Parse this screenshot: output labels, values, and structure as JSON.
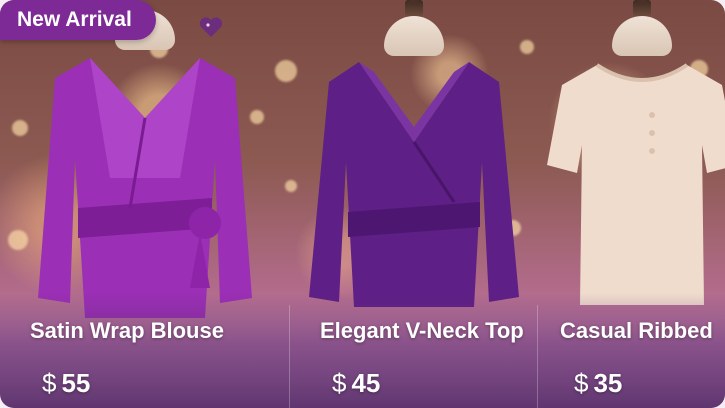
{
  "badge": {
    "label": "New Arrival"
  },
  "colors": {
    "badge_bg": "#7d2a97",
    "accent": "#6d2d7d"
  },
  "products": [
    {
      "name": "Satin Wrap Blouse",
      "currency": "$",
      "price": "55",
      "garment_color": "#9b2fb5"
    },
    {
      "name": "Elegant V-Neck Top",
      "currency": "$",
      "price": "45",
      "garment_color": "#5e1f86"
    },
    {
      "name": "Casual Ribbed",
      "currency": "$",
      "price": "35",
      "garment_color": "#f0dccd"
    }
  ],
  "icons": {
    "favorite": "heart-icon"
  }
}
